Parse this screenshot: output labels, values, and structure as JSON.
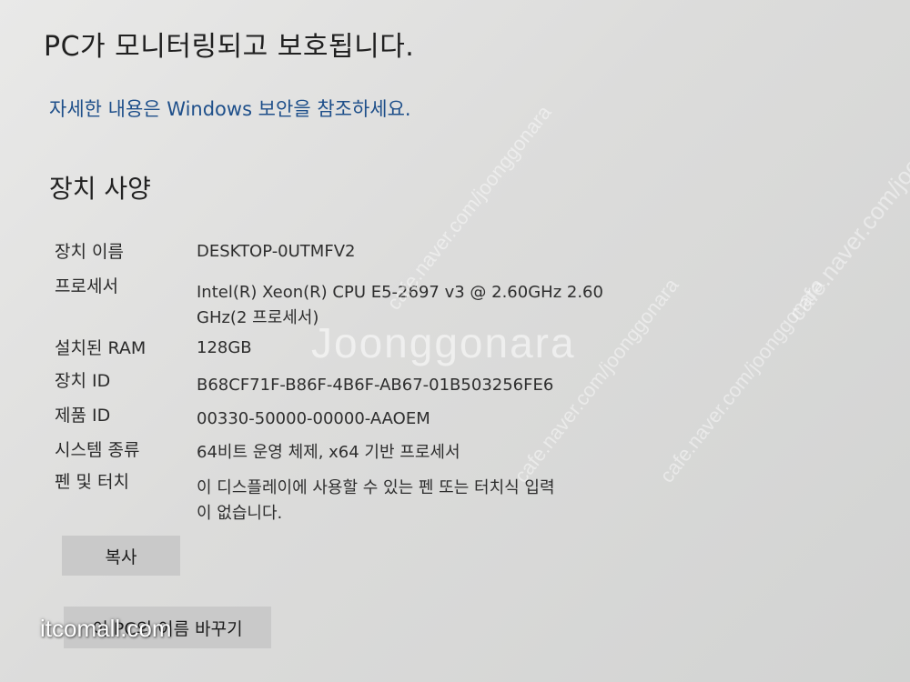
{
  "header": {
    "status_text": "PC가 모니터링되고 보호됩니다.",
    "more_info_link": "자세한 내용은 Windows 보안을 참조하세요."
  },
  "device_spec": {
    "title": "장치 사양",
    "rows": [
      {
        "label": "장치 이름",
        "value_lines": [
          "DESKTOP-0UTMFV2"
        ]
      },
      {
        "label": "프로세서",
        "value_lines": [
          "Intel(R) Xeon(R) CPU E5-2697 v3 @ 2.60GHz   2.60",
          "GHz(2 프로세서)"
        ]
      },
      {
        "label": "설치된 RAM",
        "value_lines": [
          "128GB"
        ]
      },
      {
        "label": "장치 ID",
        "value_lines": [
          "B68CF71F-B86F-4B6F-AB67-01B503256FE6"
        ]
      },
      {
        "label": "제품 ID",
        "value_lines": [
          "00330-50000-00000-AAOEM"
        ]
      },
      {
        "label": "시스템 종류",
        "value_lines": [
          "64비트 운영 체제, x64 기반 프로세서"
        ]
      },
      {
        "label": "펜 및 터치",
        "value_lines": [
          "이 디스플레이에 사용할 수 있는 펜 또는 터치식 입력",
          "이 없습니다."
        ]
      }
    ]
  },
  "buttons": {
    "copy_label": "복사",
    "rename_label": "이 PC의 이름 바꾸기"
  },
  "watermarks": {
    "logo": "Joonggonara",
    "diagonal": "cafe.naver.com/joonggonara",
    "corner": "itcomall.com"
  },
  "colors": {
    "background": "#dcdcdb",
    "link": "#1e4f8a",
    "button": "#c9c9c9",
    "text": "#202020"
  }
}
